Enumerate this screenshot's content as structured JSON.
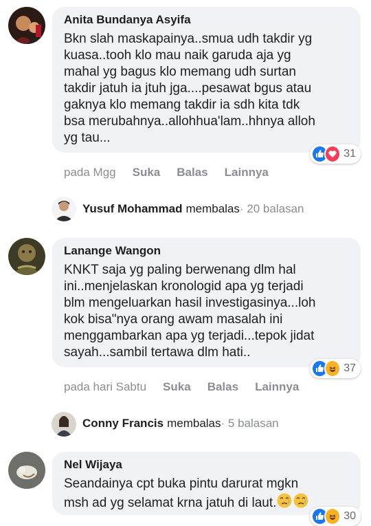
{
  "comments": [
    {
      "author": "Anita Bundanya Asyifa",
      "text": "Bkn slah maskapainya..smua udh takdir yg\nkuasa..tooh klo mau naik garuda aja yg\nmahal yg bagus klo memang udh surtan\ntakdir jatuh ia jtuh jga....pesawat bgus atau\ngaknya klo memang takdir ia sdh kita tdk\nbsa merubahnya..allohhua'lam..hhnya alloh\nyg tau...",
      "reactions": [
        "like",
        "love"
      ],
      "reaction_count": "31",
      "time": "pada Mgg",
      "actions": [
        "Suka",
        "Balas",
        "Lainnya"
      ],
      "reply": {
        "name": "Yusuf Mohammad",
        "verb": "membalas",
        "count": " · 20 balasan"
      }
    },
    {
      "author": "Lanange Wangon",
      "text": "KNKT saja yg paling berwenang dlm hal\nini..menjelaskan kronologid apa yg terjadi\nblm mengeluarkan hasil investigasinya...loh\nkok bisa\"nya orang awam masalah ini\nmenggambarkan apa yg terjadi...tepok jidat\nsayah...sambil tertawa dlm hati..",
      "reactions": [
        "like",
        "haha"
      ],
      "reaction_count": "37",
      "time": "pada hari Sabtu",
      "actions": [
        "Suka",
        "Balas",
        "Lainnya"
      ],
      "reply": {
        "name": "Conny Francis",
        "verb": "membalas",
        "count": " · 5 balasan"
      }
    },
    {
      "author": "Nel Wijaya",
      "text": "Seandainya cpt buka pintu darurat mgkn\nmsh ad yg selamat krna jatuh di laut.",
      "emojis": [
        "disappointed-relieved-emoji",
        "disappointed-relieved-emoji"
      ],
      "reactions": [
        "like",
        "haha"
      ],
      "reaction_count": "30"
    }
  ],
  "colors": {
    "bubble": "#f0f2f5",
    "secondary_text": "#8a8d91",
    "like_blue": "#1877f2",
    "love_red": "#f33e58",
    "haha_yellow": "#f7b125"
  }
}
